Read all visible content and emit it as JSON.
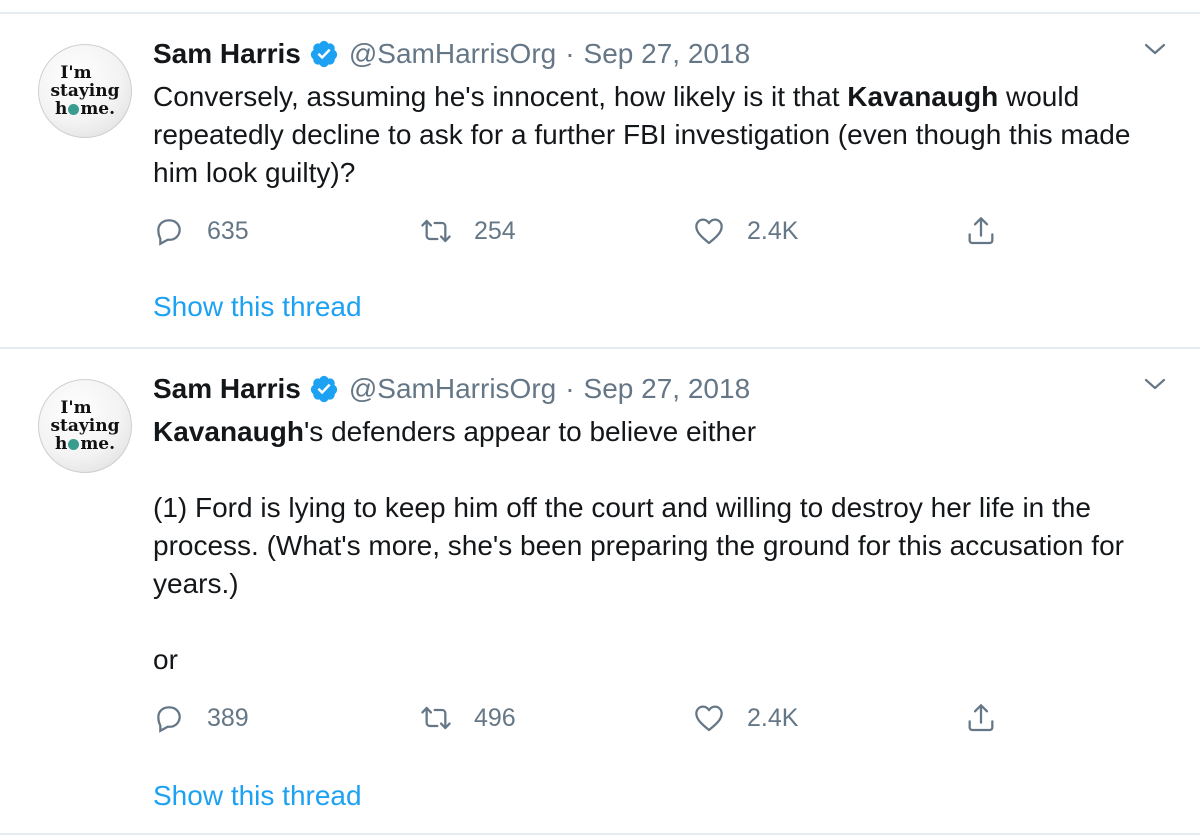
{
  "tweets": [
    {
      "author": {
        "name": "Sam Harris",
        "handle": "@SamHarrisOrg",
        "avatar_lines": [
          "I'm",
          "staying",
          "h",
          "me."
        ]
      },
      "date": "Sep 27, 2018",
      "separator": "·",
      "body": {
        "p1_a": "Conversely, assuming he's innocent, how likely is it that ",
        "p1_bold": "Kavanaugh",
        "p1_b": " would repeatedly decline to ask for a further FBI investigation (even though this made him look guilty)?"
      },
      "stats": {
        "replies": "635",
        "retweets": "254",
        "likes": "2.4K"
      },
      "thread_link": "Show this thread"
    },
    {
      "author": {
        "name": "Sam Harris",
        "handle": "@SamHarrisOrg",
        "avatar_lines": [
          "I'm",
          "staying",
          "h",
          "me."
        ]
      },
      "date": "Sep 27, 2018",
      "separator": "·",
      "body": {
        "p1_bold": "Kavanaugh",
        "p1_b": "'s defenders appear to believe either",
        "p2": "(1) Ford is lying to keep him off the court and willing to destroy her life in the process. (What's more, she's been preparing the ground for this accusation for years.)",
        "p3": "or"
      },
      "stats": {
        "replies": "389",
        "retweets": "496",
        "likes": "2.4K"
      },
      "thread_link": "Show this thread"
    }
  ],
  "colors": {
    "text": "#14171a",
    "secondary": "#657786",
    "link": "#1da1f2",
    "verified": "#1da1f2",
    "divider": "#e6ecf0",
    "avatar_globe": "#3a9b8f"
  },
  "icons": [
    "reply-icon",
    "retweet-icon",
    "like-icon",
    "share-icon",
    "verified-badge-icon",
    "chevron-down-icon"
  ]
}
